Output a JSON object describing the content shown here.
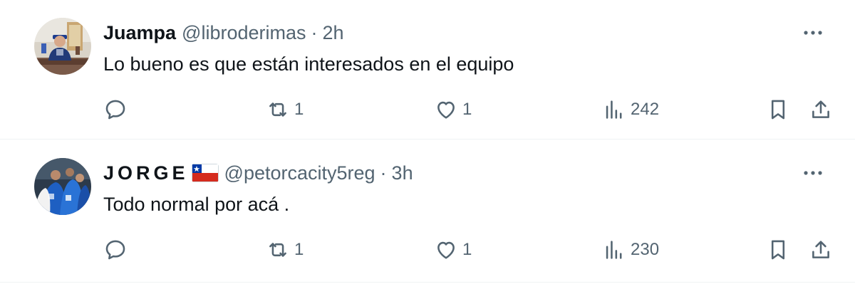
{
  "tweets": [
    {
      "name": "Juampa",
      "handle": "@libroderimas",
      "separator": "·",
      "time": "2h",
      "text": "Lo bueno es que están interesados en el equipo",
      "replies": "",
      "retweets": "1",
      "likes": "1",
      "views": "242"
    },
    {
      "name": "JORGE",
      "handle": "@petorcacity5reg",
      "separator": "·",
      "time": "3h",
      "text": "Todo normal por acá .",
      "replies": "",
      "retweets": "1",
      "likes": "1",
      "views": "230"
    }
  ],
  "icons": {
    "more": "more-dots-icon",
    "reply": "reply-bubble-icon",
    "retweet": "retweet-arrows-icon",
    "like": "heart-icon",
    "views": "views-bars-icon",
    "bookmark": "bookmark-icon",
    "share": "share-upload-icon",
    "flag": "chile-flag-icon"
  },
  "colors": {
    "text_primary": "#0f1419",
    "text_secondary": "#536471",
    "divider": "#eff3f4"
  }
}
